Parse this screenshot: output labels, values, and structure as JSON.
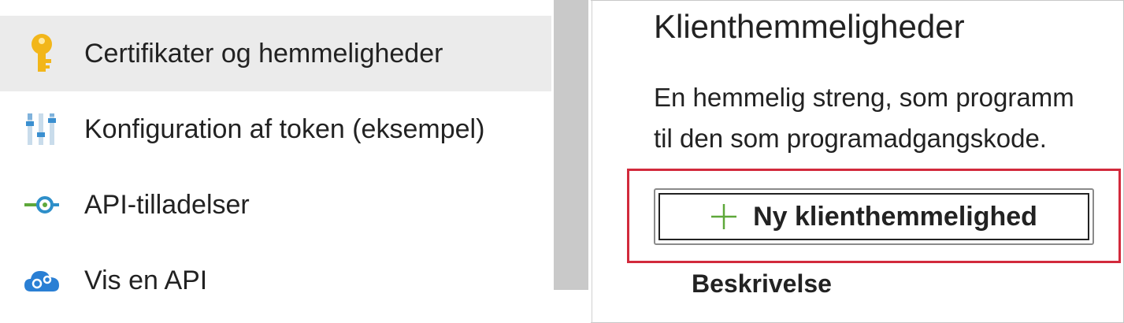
{
  "sidebar": {
    "items": [
      {
        "label": "Certifikater og hemmeligheder",
        "icon": "key-icon",
        "selected": true
      },
      {
        "label": "Konfiguration af token (eksempel)",
        "icon": "token-config-icon",
        "selected": false
      },
      {
        "label": "API-tilladelser",
        "icon": "api-permissions-icon",
        "selected": false
      },
      {
        "label": "Vis en API",
        "icon": "expose-api-cloud-icon",
        "selected": false
      }
    ]
  },
  "main": {
    "title": "Klienthemmeligheder",
    "description_line1": "En hemmelig streng, som programm",
    "description_line2": "til den som programadgangskode.",
    "new_secret_button": {
      "icon": "plus-icon",
      "label": "Ny klienthemmelighed"
    },
    "table": {
      "columns": [
        "Beskrivelse"
      ]
    }
  },
  "colors": {
    "selected_bg": "#ebebeb",
    "highlight_border": "#d22a3c",
    "plus_green": "#5ea83a",
    "key_yellow": "#f2b61a"
  }
}
